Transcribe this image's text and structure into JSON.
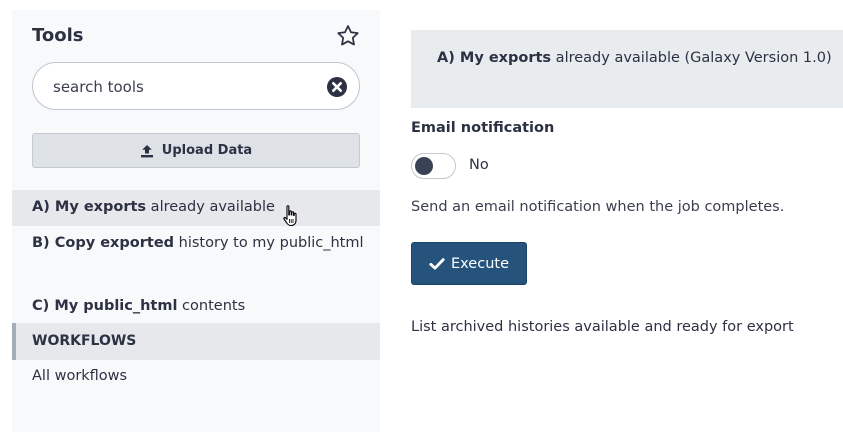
{
  "tool_panel": {
    "title": "Tools",
    "search": {
      "placeholder": "search tools",
      "value": ""
    },
    "upload_label": "Upload Data",
    "tools": [
      {
        "bold": "A) My exports",
        "rest": " already available",
        "hovered": true
      },
      {
        "bold": "B) Copy exported",
        "rest": " history to my public_html",
        "hovered": false
      },
      {
        "bold": "C) My public_html",
        "rest": " contents",
        "hovered": false
      }
    ],
    "workflows_section": "WORKFLOWS",
    "workflows_link": "All workflows"
  },
  "tool_form": {
    "header_bold": "A) My exports",
    "header_rest": " already available (Galaxy Version 1.0)",
    "email": {
      "label": "Email notification",
      "toggle_state": "No",
      "help": "Send an email notification when the job completes."
    },
    "execute_label": "Execute",
    "help_text": "List archived histories available and ready for export"
  },
  "colors": {
    "panel_bg": "#f8f9fa",
    "hover_bg": "#e6e8ec",
    "primary_button": "#25537b",
    "text": "#2c3143"
  },
  "icons": [
    "star-icon",
    "clear-search-icon",
    "upload-icon",
    "hand-cursor-icon",
    "check-icon"
  ]
}
